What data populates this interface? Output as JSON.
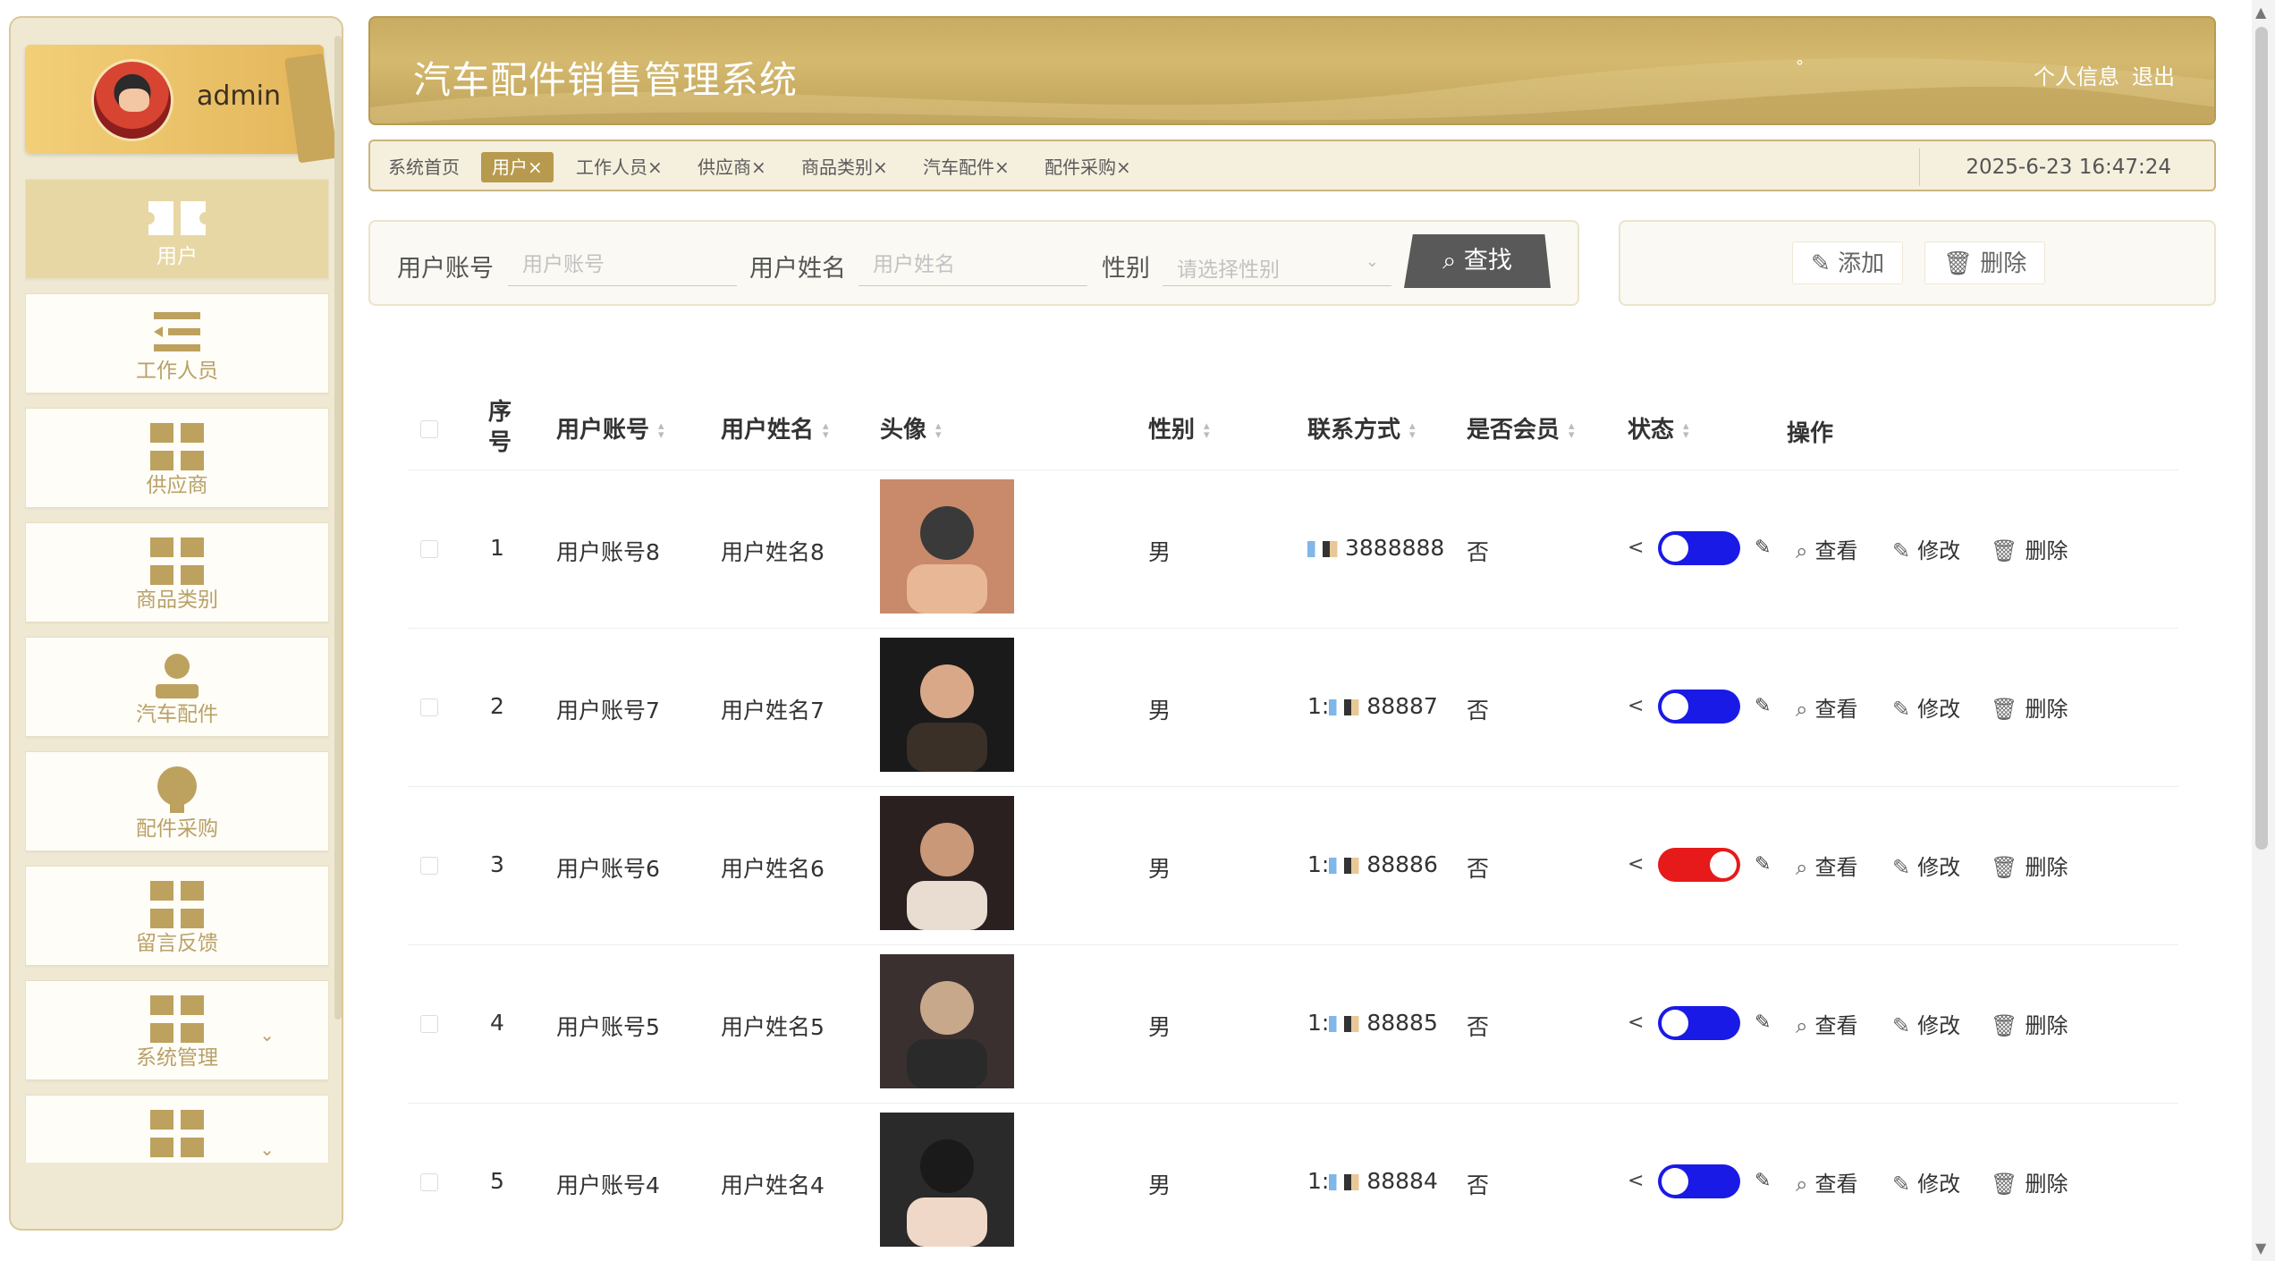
{
  "user": {
    "name": "admin"
  },
  "sidebar": {
    "items": [
      {
        "label": "用户",
        "icon": "ticket-icon",
        "active": true
      },
      {
        "label": "工作人员",
        "icon": "list-icon"
      },
      {
        "label": "供应商",
        "icon": "grid-icon"
      },
      {
        "label": "商品类别",
        "icon": "grid-icon"
      },
      {
        "label": "汽车配件",
        "icon": "person-icon"
      },
      {
        "label": "配件采购",
        "icon": "bulb-icon"
      },
      {
        "label": "留言反馈",
        "icon": "grid-icon"
      },
      {
        "label": "系统管理",
        "icon": "grid-icon",
        "has_children": true
      },
      {
        "label": "",
        "icon": "grid-icon",
        "has_children": true
      }
    ]
  },
  "header": {
    "title": "汽车配件销售管理系统",
    "dot": "°",
    "profile_label": "个人信息",
    "logout_label": "退出"
  },
  "tabs": {
    "items": [
      {
        "label": "系统首页"
      },
      {
        "label": "用户×",
        "active": true
      },
      {
        "label": "工作人员×"
      },
      {
        "label": "供应商×"
      },
      {
        "label": "商品类别×"
      },
      {
        "label": "汽车配件×"
      },
      {
        "label": "配件采购×"
      }
    ],
    "datetime": "2025-6-23 16:47:24"
  },
  "search": {
    "account_label": "用户账号",
    "account_placeholder": "用户账号",
    "name_label": "用户姓名",
    "name_placeholder": "用户姓名",
    "gender_label": "性别",
    "gender_placeholder": "请选择性别",
    "search_button": "查找"
  },
  "actions": {
    "add_label": "添加",
    "delete_label": "删除"
  },
  "table": {
    "columns": {
      "index": "序号",
      "account": "用户账号",
      "name": "用户姓名",
      "avatar": "头像",
      "gender": "性别",
      "contact": "联系方式",
      "member": "是否会员",
      "status": "状态",
      "ops": "操作"
    },
    "op_labels": {
      "view": "查看",
      "edit": "修改",
      "delete": "删除"
    },
    "rows": [
      {
        "index": "1",
        "account": "用户账号8",
        "name": "用户姓名8",
        "gender": "男",
        "contact_prefix": "",
        "contact_suffix": "3888888",
        "member": "否",
        "status_on": false
      },
      {
        "index": "2",
        "account": "用户账号7",
        "name": "用户姓名7",
        "gender": "男",
        "contact_prefix": "1:",
        "contact_suffix": "88887",
        "member": "否",
        "status_on": false
      },
      {
        "index": "3",
        "account": "用户账号6",
        "name": "用户姓名6",
        "gender": "男",
        "contact_prefix": "1:",
        "contact_suffix": "88886",
        "member": "否",
        "status_on": true
      },
      {
        "index": "4",
        "account": "用户账号5",
        "name": "用户姓名5",
        "gender": "男",
        "contact_prefix": "1:",
        "contact_suffix": "88885",
        "member": "否",
        "status_on": false
      },
      {
        "index": "5",
        "account": "用户账号4",
        "name": "用户姓名4",
        "gender": "男",
        "contact_prefix": "1:",
        "contact_suffix": "88884",
        "member": "否",
        "status_on": false
      }
    ]
  },
  "colors": {
    "accent": "#b89a4e",
    "switch_off": "#1a1ae6",
    "switch_on": "#e61a1a"
  }
}
